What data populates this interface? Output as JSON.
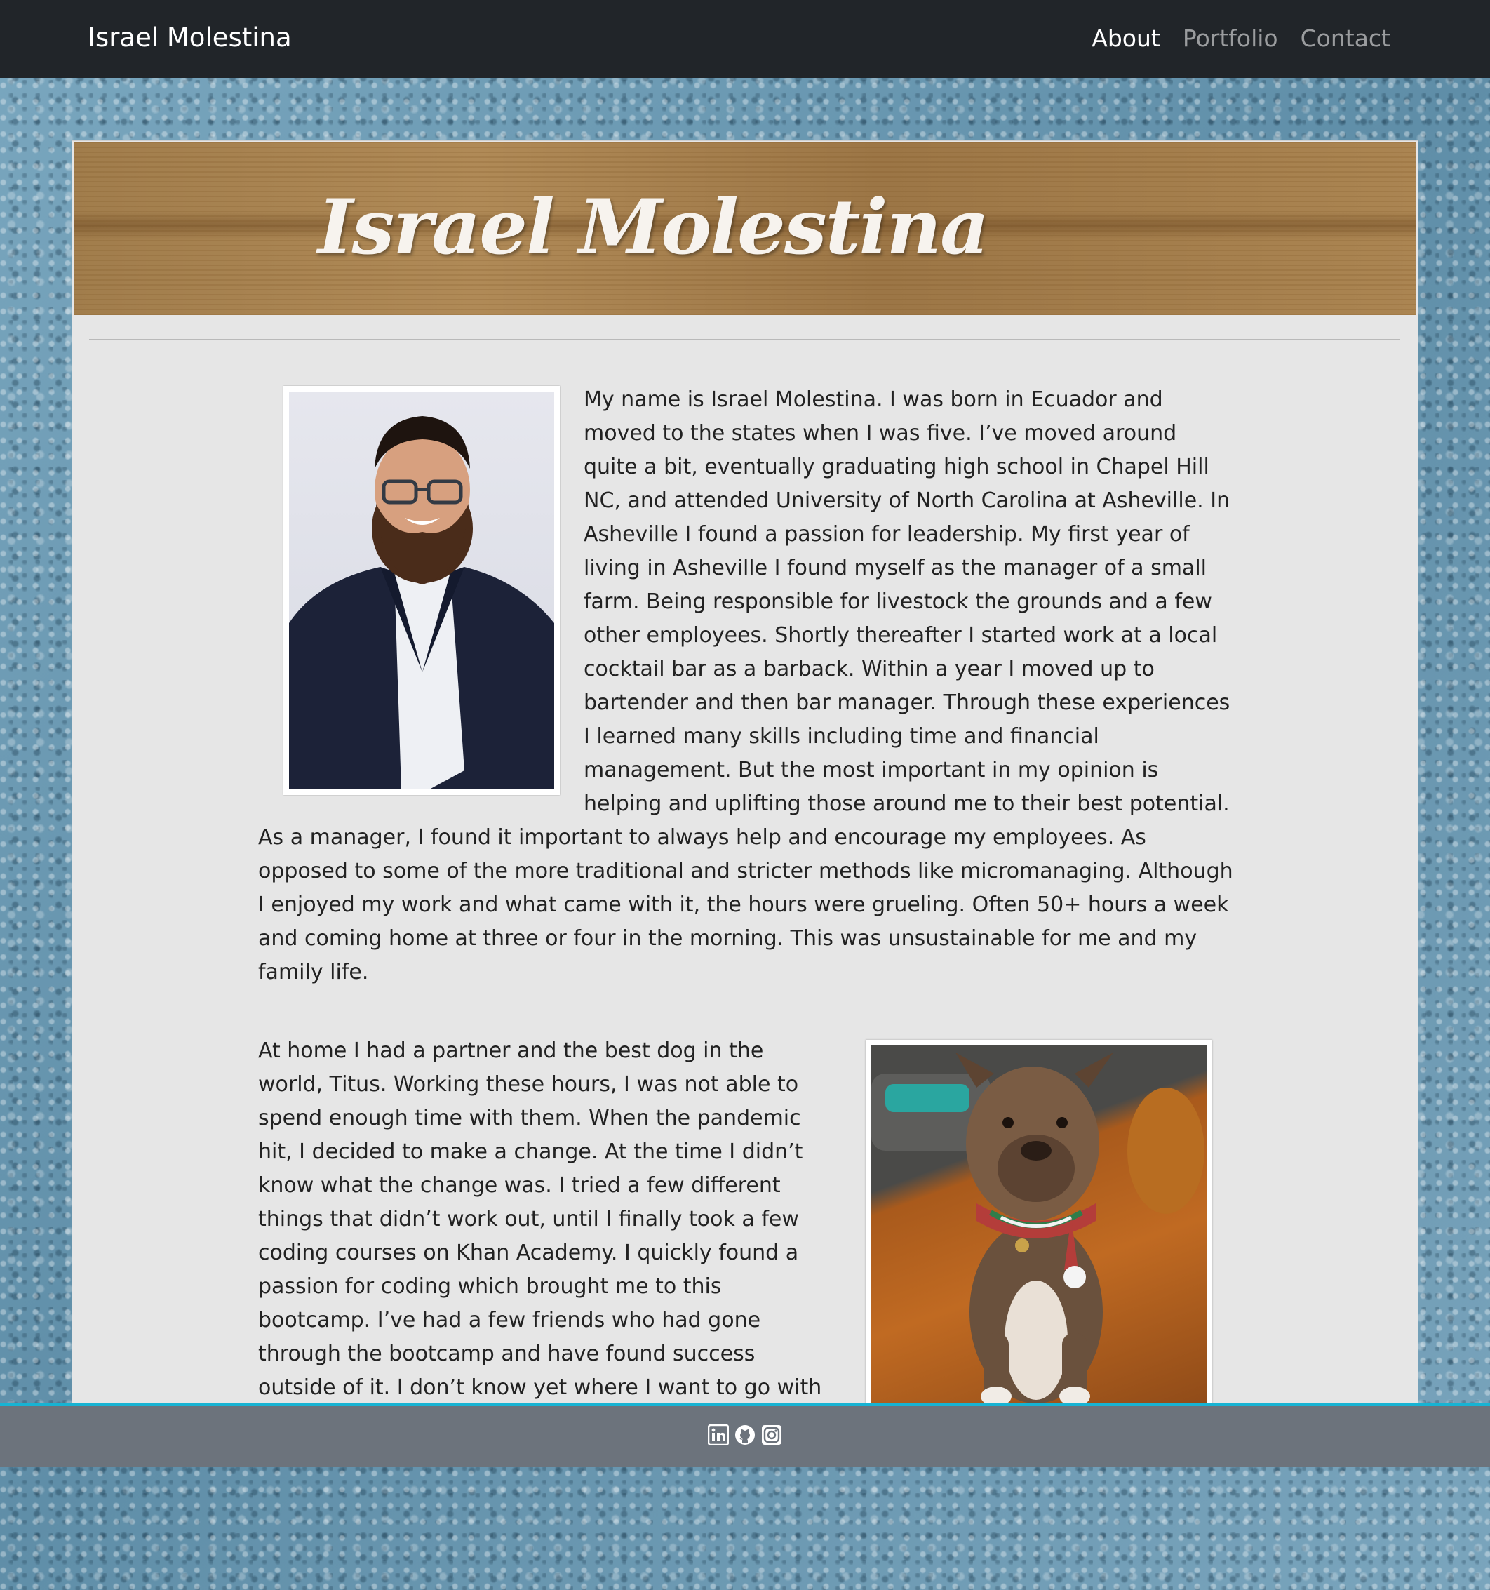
{
  "navbar": {
    "brand": "Israel Molestina",
    "links": [
      {
        "label": "About",
        "active": true
      },
      {
        "label": "Portfolio",
        "active": false
      },
      {
        "label": "Contact",
        "active": false
      }
    ]
  },
  "header": {
    "title": "Israel Molestina"
  },
  "about": {
    "photo_alt": "portrait",
    "paragraph1": "My name is Israel Molestina. I was born in Ecuador and moved to the states when I was five. I’ve moved around quite a bit, eventually graduating high school in Chapel Hill NC, and attended University of North Carolina at Asheville. In Asheville I found a passion for leadership. My first year of living in Asheville I found myself as the manager of a small farm. Being responsible for livestock the grounds and a few other employees. Shortly thereafter I started work at a local cocktail bar as a barback. Within a year I moved up to bartender and then bar manager. Through these experiences I learned many skills including time and financial management. But the most important in my opinion is helping and uplifting those around me to their best potential. As a manager, I found it important to always help and encourage my employees. As opposed to some of the more traditional and stricter methods like micromanaging. Although I enjoyed my work and what came with it, the hours were grueling. Often 50+ hours a week and coming home at three or four in the morning. This was unsustainable for me and my family life.",
    "paragraph2": "At home I had a partner and the best dog in the world, Titus. Working these hours, I was not able to spend enough time with them. When the pandemic hit, I decided to make a change. At the time I didn’t know what the change was. I tried a few different things that didn’t work out, until I finally took a few coding courses on Khan Academy. I quickly found a passion for coding which brought me to this bootcamp. I’ve had a few friends who had gone through the bootcamp and have found success outside of it. I don’t know yet where I want to go with this new skill set, but I am very excited for what the future holds. I am looking forward to"
  },
  "footer": {
    "icons": [
      "linkedin-icon",
      "github-icon",
      "instagram-icon"
    ]
  },
  "colors": {
    "navbar": "#212529",
    "footer": "#6c737c",
    "footer_border": "#17b3d3",
    "card": "#e6e6e6"
  }
}
